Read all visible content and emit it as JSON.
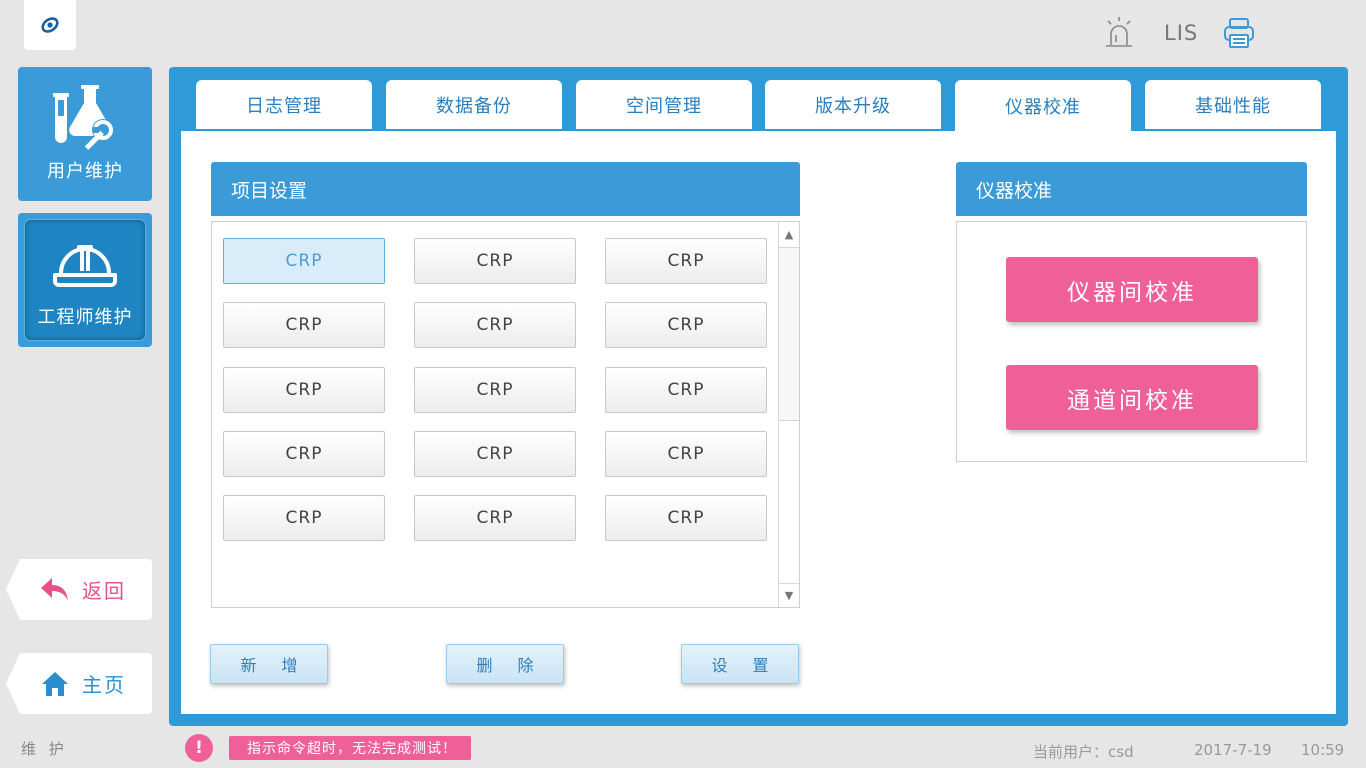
{
  "header": {
    "lis_label": "LIS"
  },
  "sidebar": {
    "user_maintenance": "用户维护",
    "engineer_maintenance": "工程师维护",
    "back": "返回",
    "home": "主页",
    "section": "维 护"
  },
  "tabs": [
    {
      "label": "日志管理",
      "active": false
    },
    {
      "label": "数据备份",
      "active": false
    },
    {
      "label": "空间管理",
      "active": false
    },
    {
      "label": "版本升级",
      "active": false
    },
    {
      "label": "仪器校准",
      "active": true
    },
    {
      "label": "基础性能",
      "active": false
    }
  ],
  "project_settings": {
    "title": "项目设置",
    "items": [
      [
        "CRP",
        "CRP",
        "CRP"
      ],
      [
        "CRP",
        "CRP",
        "CRP"
      ],
      [
        "CRP",
        "CRP",
        "CRP"
      ],
      [
        "CRP",
        "CRP",
        "CRP"
      ],
      [
        "CRP",
        "CRP",
        "CRP"
      ]
    ],
    "selected": "0-0",
    "buttons": {
      "add": "新 增",
      "delete": "删 除",
      "settings": "设 置"
    }
  },
  "calibration": {
    "title": "仪器校准",
    "inter_instrument": "仪器间校准",
    "inter_channel": "通道间校准"
  },
  "status": {
    "alert_icon": "!",
    "alert_message": "指示命令超时，无法完成测试！",
    "current_user": "当前用户：csd",
    "date": "2017-7-19",
    "time": "10:59"
  },
  "colors": {
    "accent_blue": "#3a9bd8",
    "alert_pink": "#ef5f98"
  }
}
